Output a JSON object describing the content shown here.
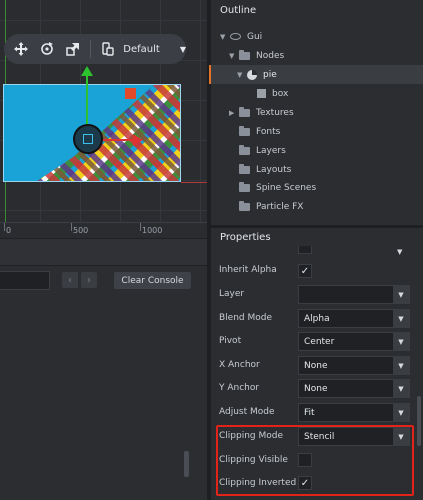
{
  "scene": {
    "toolbar": {
      "layout_value": "Default"
    },
    "ruler": [
      "0",
      "500",
      "1000"
    ]
  },
  "console": {
    "clear_label": "Clear Console",
    "prev_glyph": "‹",
    "next_glyph": "›"
  },
  "outline": {
    "title": "Outline",
    "items": [
      {
        "label": "Gui",
        "icon": "gui-icon"
      },
      {
        "label": "Nodes",
        "icon": "folder-icon"
      },
      {
        "label": "pie",
        "icon": "pie-node-icon"
      },
      {
        "label": "box",
        "icon": "box-node-icon"
      },
      {
        "label": "Textures",
        "icon": "folder-icon"
      },
      {
        "label": "Fonts",
        "icon": "folder-icon"
      },
      {
        "label": "Layers",
        "icon": "folder-icon"
      },
      {
        "label": "Layouts",
        "icon": "folder-icon"
      },
      {
        "label": "Spine Scenes",
        "icon": "folder-icon"
      },
      {
        "label": "Particle FX",
        "icon": "folder-icon"
      }
    ]
  },
  "properties": {
    "title": "Properties",
    "rows": [
      {
        "label": "Inherit Alpha",
        "type": "checkbox",
        "checked": "✓"
      },
      {
        "label": "Layer",
        "type": "select",
        "value": ""
      },
      {
        "label": "Blend Mode",
        "type": "select",
        "value": "Alpha"
      },
      {
        "label": "Pivot",
        "type": "select",
        "value": "Center"
      },
      {
        "label": "X Anchor",
        "type": "select",
        "value": "None"
      },
      {
        "label": "Y Anchor",
        "type": "select",
        "value": "None"
      },
      {
        "label": "Adjust Mode",
        "type": "select",
        "value": "Fit"
      },
      {
        "label": "Clipping Mode",
        "type": "select",
        "value": "Stencil"
      },
      {
        "label": "Clipping Visible",
        "type": "checkbox",
        "checked": ""
      },
      {
        "label": "Clipping Inverted",
        "type": "checkbox",
        "checked": "✓"
      }
    ]
  },
  "colors": {
    "highlight": "#e2231a",
    "selection_accent": "#e2742a",
    "gizmo_x": "#dd3333",
    "gizmo_y": "#2ec12e"
  }
}
